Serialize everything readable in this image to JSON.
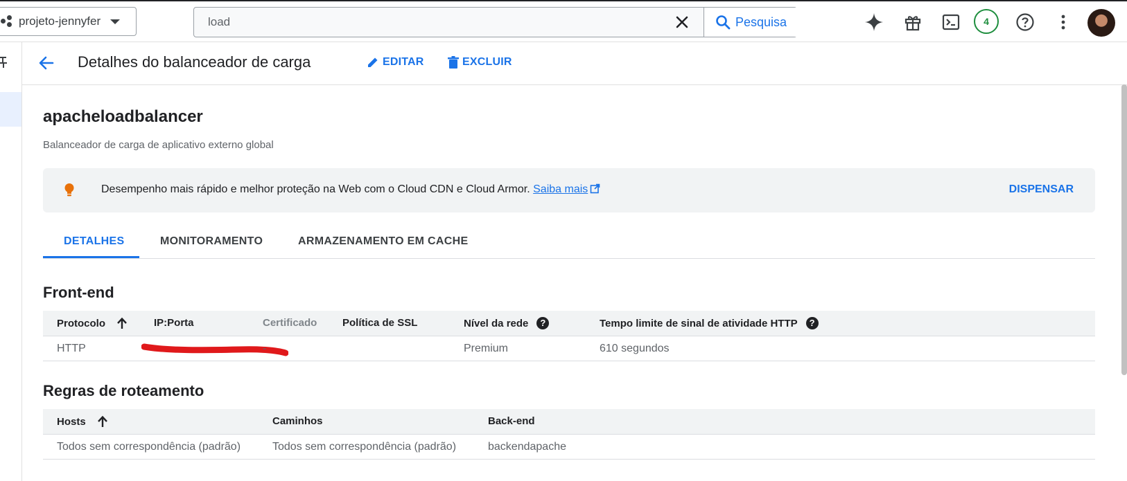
{
  "topbar": {
    "project_name": "projeto-jennyfer",
    "search_value": "load",
    "search_button": "Pesquisa",
    "notification_count": "4"
  },
  "header": {
    "title": "Detalhes do balanceador de carga",
    "edit_label": "EDITAR",
    "delete_label": "EXCLUIR"
  },
  "lb": {
    "name": "apacheloadbalancer",
    "subtitle": "Balanceador de carga de aplicativo externo global"
  },
  "banner": {
    "message": "Desempenho mais rápido e melhor proteção na Web com o Cloud CDN e Cloud Armor.",
    "link": "Saiba mais",
    "dismiss": "DISPENSAR"
  },
  "tabs": [
    "DETALHES",
    "MONITORAMENTO",
    "ARMAZENAMENTO EM CACHE"
  ],
  "frontend": {
    "title": "Front-end",
    "columns": [
      "Protocolo",
      "IP:Porta",
      "Certificado",
      "Política de SSL",
      "Nível da rede",
      "Tempo limite de sinal de atividade HTTP"
    ],
    "row": {
      "protocol": "HTTP",
      "ip_port": "",
      "certificate": "-",
      "ssl_policy": "",
      "network_tier": "Premium",
      "timeout": "610 segundos"
    }
  },
  "routing": {
    "title": "Regras de roteamento",
    "columns": [
      "Hosts",
      "Caminhos",
      "Back-end"
    ],
    "row": {
      "hosts": "Todos sem correspondência (padrão)",
      "paths": "Todos sem correspondência (padrão)",
      "backend": "backendapache"
    }
  },
  "colors": {
    "accent": "#1a73e8",
    "bulb": "#e8710a",
    "badge": "#1e8e3e",
    "redaction": "#e0191b"
  }
}
